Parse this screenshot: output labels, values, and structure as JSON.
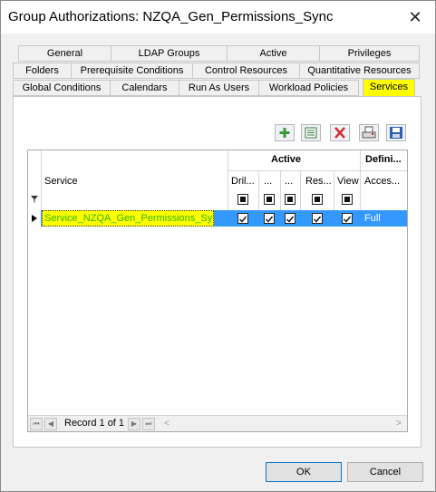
{
  "window": {
    "title": "Group Authorizations: NZQA_Gen_Permissions_Sync",
    "close_glyph": "✕"
  },
  "tabs": {
    "row1": [
      "General",
      "LDAP Groups",
      "Active",
      "Privileges"
    ],
    "row2": [
      "Folders",
      "Prerequisite Conditions",
      "Control Resources",
      "Quantitative Resources"
    ],
    "row3": [
      "Global Conditions",
      "Calendars",
      "Run As Users",
      "Workload Policies",
      "Services"
    ],
    "selected": "Services"
  },
  "toolbar": {
    "icons": [
      "add-icon",
      "properties-icon",
      "delete-icon",
      "print-icon",
      "save-icon"
    ],
    "colors": {
      "add": "#3a9a3a",
      "delete": "#d03030"
    }
  },
  "grid": {
    "group_active": "Active",
    "group_defini": "Defini...",
    "col_service": "Service",
    "col_drill": "Dril...",
    "col_c2": "...",
    "col_c3": "...",
    "col_res": "Res...",
    "col_view": "View",
    "col_access": "Acces...",
    "row": {
      "service": "Service_NZQA_Gen_Permissions_Sync*",
      "access": "Full"
    },
    "colors": {
      "row_bg": "#3399ff",
      "highlight": "#ffff00",
      "service_text": "#2db400"
    }
  },
  "nav": {
    "record_text": "Record 1 of 1"
  },
  "buttons": {
    "ok": "OK",
    "cancel": "Cancel"
  }
}
